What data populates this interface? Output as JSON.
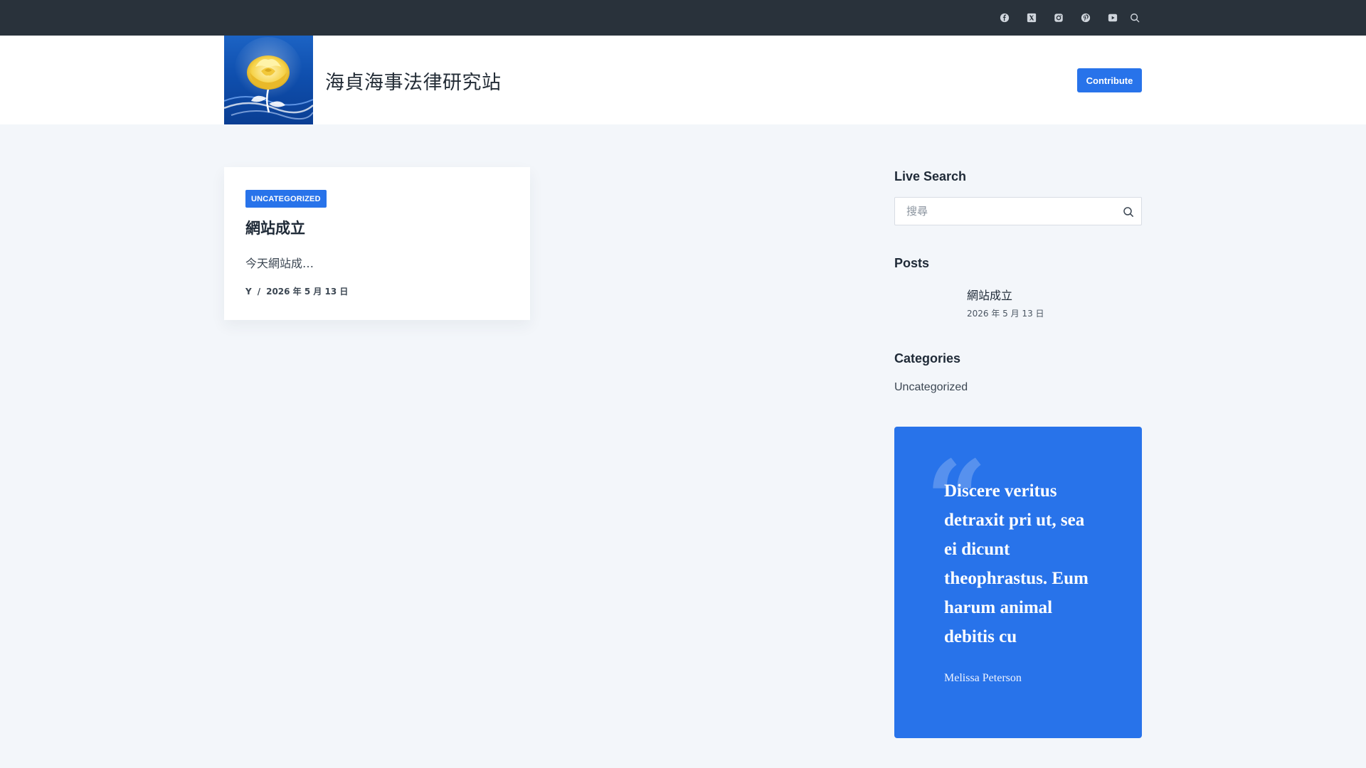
{
  "top_bar": {
    "social_icons": [
      "facebook-icon",
      "x-twitter-icon",
      "instagram-icon",
      "pinterest-icon",
      "youtube-icon",
      "search-icon"
    ]
  },
  "header": {
    "logo": "yellow-rose-on-blue-waves",
    "site_title": "海貞海事法律研究站",
    "contribute_label": "Contribute"
  },
  "post": {
    "category": "UNCATEGORIZED",
    "title": "網站成立",
    "excerpt": "今天網站成…",
    "author": "Y",
    "separator": "/",
    "date": "2026 年 5 月 13 日"
  },
  "sidebar": {
    "live_search": {
      "title": "Live Search",
      "placeholder": "搜尋"
    },
    "posts": {
      "title": "Posts",
      "items": [
        {
          "title": "網站成立",
          "date": "2026 年 5 月 13 日"
        }
      ]
    },
    "categories": {
      "title": "Categories",
      "items": [
        "Uncategorized"
      ]
    },
    "quote": {
      "text": "Discere veritus detraxit pri ut, sea ei dicunt theophrastus. Eum harum animal debitis cu",
      "author": "Melissa Peterson"
    }
  },
  "colors": {
    "accent": "#2873ea",
    "top_bar": "#29323b",
    "page_bg": "#f3f6fa"
  }
}
